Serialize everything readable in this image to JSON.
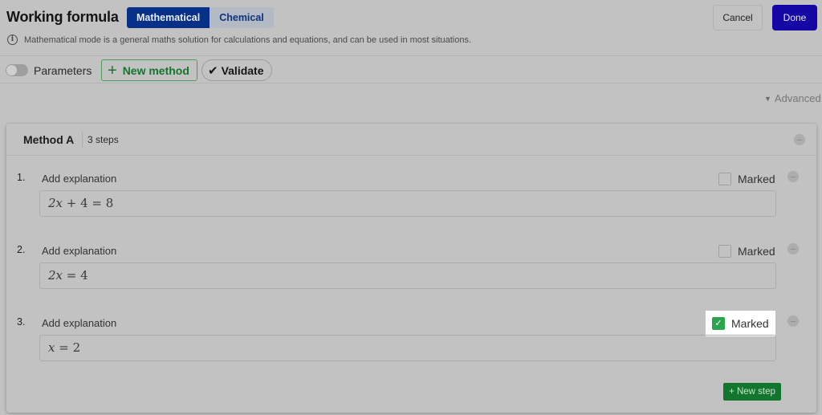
{
  "header": {
    "title": "Working formula",
    "modes": [
      {
        "label": "Mathematical",
        "active": true
      },
      {
        "label": "Chemical",
        "active": false
      }
    ],
    "info_icon": "info-circle-icon",
    "info_text": "Mathematical mode is a general maths solution for calculations and equations, and can be used in most situations.",
    "cancel_label": "Cancel",
    "done_label": "Done"
  },
  "toolbar": {
    "parameters_label": "Parameters",
    "parameters_enabled": false,
    "new_method_icon": "plus-icon",
    "new_method_label": "New method",
    "validate_icon": "checkmark-icon",
    "validate_label": "Validate",
    "advanced_icon": "chevron-down-icon",
    "advanced_label": "Advanced"
  },
  "method": {
    "name": "Method A",
    "steps_count": "3 steps",
    "steps": [
      {
        "number": "1.",
        "explanation": "Add explanation",
        "formula": "2x + 4 = 8",
        "marked_label": "Marked",
        "marked": false
      },
      {
        "number": "2.",
        "explanation": "Add explanation",
        "formula": "2x = 4",
        "marked_label": "Marked",
        "marked": false
      },
      {
        "number": "3.",
        "explanation": "Add explanation",
        "formula": "x = 2",
        "marked_label": "Marked",
        "marked": true
      }
    ],
    "new_step_label": "+ New step"
  },
  "colors": {
    "primary_blue": "#073087",
    "done_blue": "#1407a3",
    "green": "#13762f",
    "check_green": "#2aa54e",
    "overlay_gray": "#c2c2c2"
  }
}
